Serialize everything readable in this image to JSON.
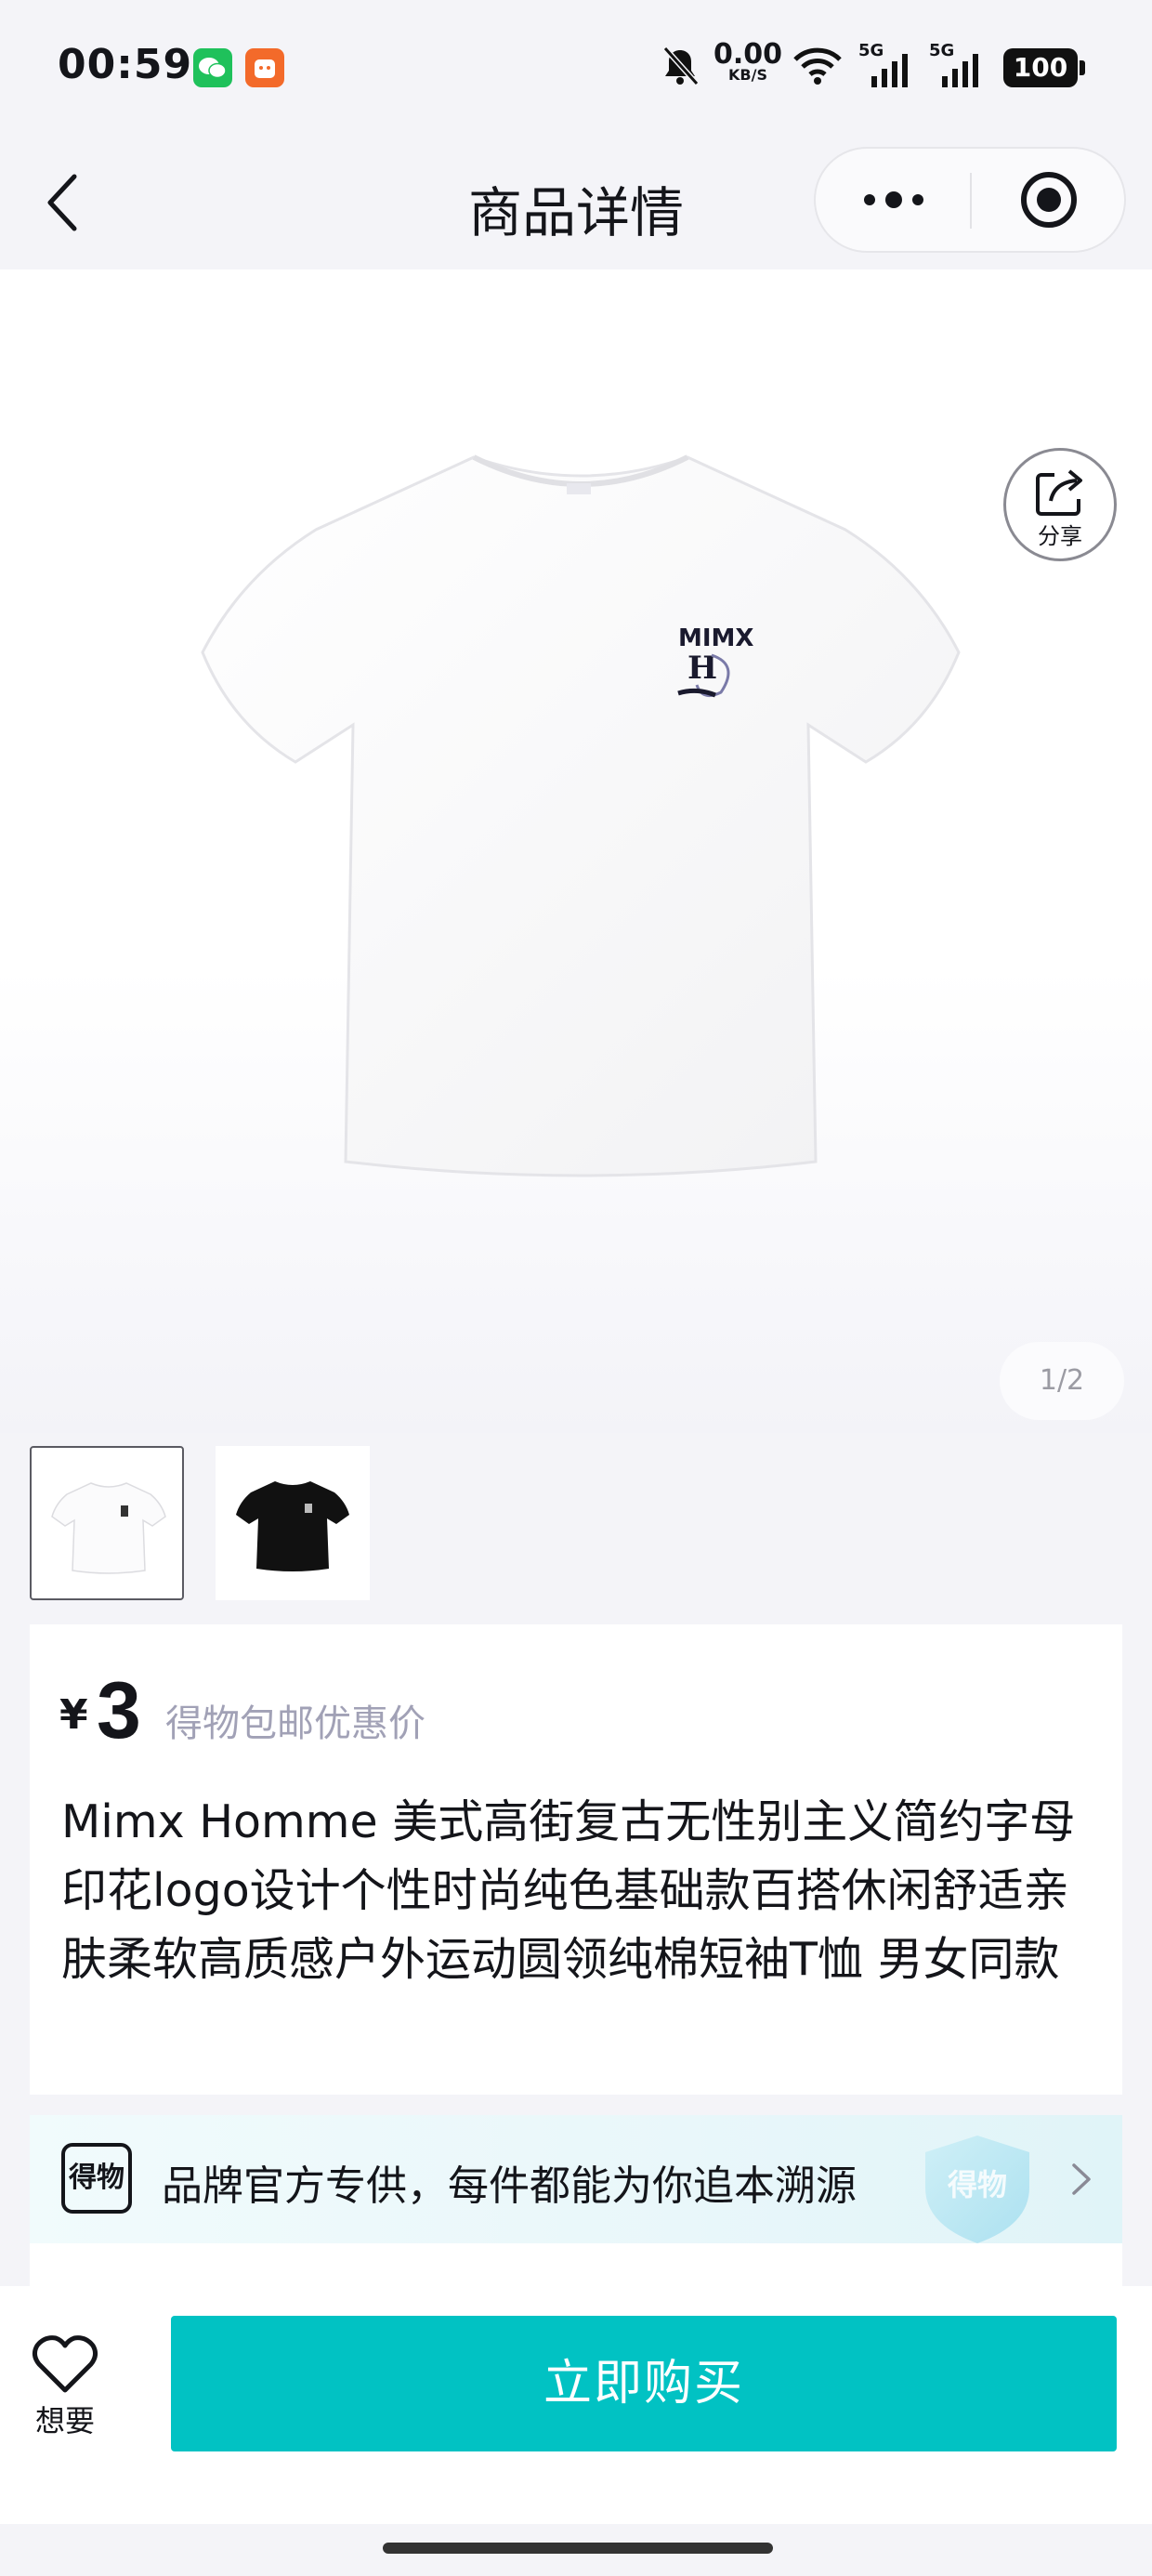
{
  "status_bar": {
    "time": "00:59",
    "net_speed": "0.00",
    "net_unit": "KB/S",
    "signal_1": "5G",
    "signal_2": "5G",
    "battery": "100",
    "icons": [
      "wechat-icon",
      "app-icon",
      "mute-bell-icon",
      "wifi-icon",
      "signal-icon",
      "signal-icon",
      "battery-icon"
    ]
  },
  "nav": {
    "title": "商品详情",
    "icons": [
      "back-icon",
      "more-icon",
      "target-icon"
    ]
  },
  "gallery": {
    "share_label": "分享",
    "page_indicator": "1/2",
    "thumbnails": [
      {
        "label": "white-tshirt",
        "selected": true
      },
      {
        "label": "black-tshirt",
        "selected": false
      }
    ]
  },
  "info": {
    "currency": "¥",
    "price": "3",
    "price_note": "得物包邮优惠价",
    "title": "Mimx Homme 美式高街复古无性别主义简约字母印花logo设计个性时尚纯色基础款百搭休闲舒适亲肤柔软高质感户外运动圆领纯棉短袖T恤 男女同款"
  },
  "brand_banner": {
    "logo_text": "得物",
    "text": "品牌官方专供，每件都能为你追本溯源",
    "shield_text": "得物"
  },
  "bottom_bar": {
    "wish_label": "想要",
    "buy_label": "立即购买"
  },
  "colors": {
    "accent": "#01c2c3",
    "background": "#f4f4f8",
    "muted_text": "#a1a1b6"
  }
}
